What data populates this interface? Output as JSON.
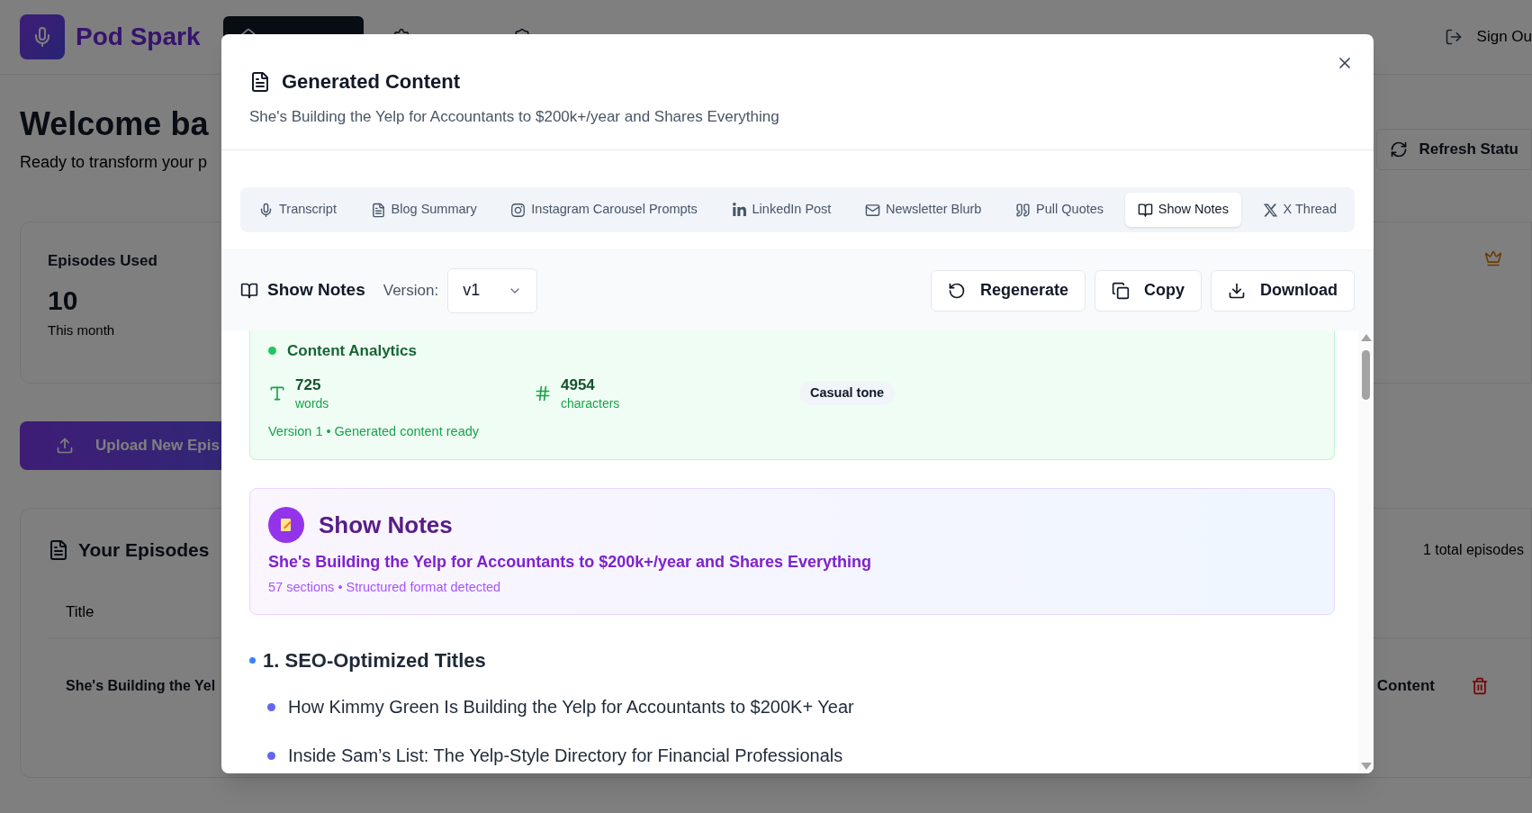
{
  "app": {
    "brand": "Pod Spark",
    "nav": [
      {
        "selected": true
      },
      {
        "selected": false
      },
      {
        "selected": false
      }
    ],
    "sign_out": "Sign Ou"
  },
  "page": {
    "heading": "Welcome ba",
    "subtitle": "Ready to transform your p",
    "refresh_button": "Refresh Statu",
    "stat_card": {
      "label": "Episodes Used",
      "value": "10",
      "caption": "This month"
    },
    "upload_button": "Upload New Epis",
    "episodes": {
      "title": "Your Episodes",
      "count": "1 total episodes",
      "column_1": "Title",
      "row": {
        "title": "She's Building the Yel",
        "column_2": "Content"
      }
    }
  },
  "dialog": {
    "title": "Generated Content",
    "subtitle": "She's Building the Yelp for Accountants to $200k+/year and Shares Everything",
    "tabs": [
      {
        "label": "Transcript",
        "selected": false
      },
      {
        "label": "Blog Summary",
        "selected": false
      },
      {
        "label": "Instagram Carousel Prompts",
        "selected": false
      },
      {
        "label": "LinkedIn Post",
        "selected": false
      },
      {
        "label": "Newsletter Blurb",
        "selected": false
      },
      {
        "label": "Pull Quotes",
        "selected": false
      },
      {
        "label": "Show Notes",
        "selected": true
      },
      {
        "label": "X Thread",
        "selected": false
      }
    ],
    "toolbar": {
      "title": "Show Notes",
      "version_label": "Version:",
      "version": "v1",
      "actions": [
        "Regenerate",
        "Copy",
        "Download"
      ]
    },
    "analytics": {
      "title": "Content Analytics",
      "stats": [
        {
          "value": "725",
          "label": "words"
        },
        {
          "value": "4954",
          "label": "characters"
        }
      ],
      "tone": "Casual tone",
      "footer": "Version 1 • Generated content ready"
    },
    "notes_card": {
      "title": "Show Notes",
      "subtitle": "She's Building the Yelp for Accountants to $200k+/year and Shares Everything",
      "meta": "57 sections • Structured format detected"
    },
    "sections": [
      {
        "heading": "1. SEO-Optimized Titles",
        "items": [
          "How Kimmy Green Is Building the Yelp for Accountants to $200K+ Year",
          "Inside Sam’s List: The Yelp-Style Directory for Financial Professionals"
        ]
      }
    ]
  }
}
